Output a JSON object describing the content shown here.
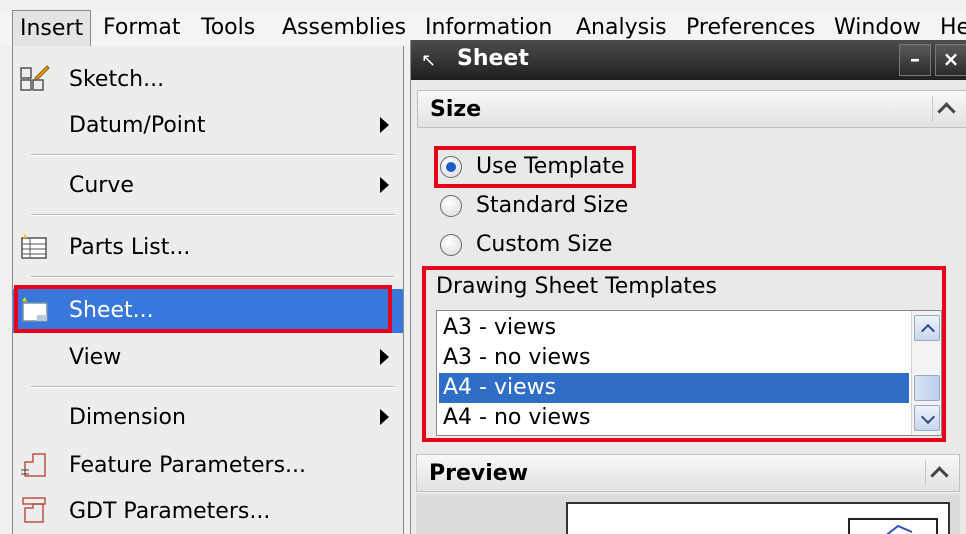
{
  "menubar": {
    "items": [
      "Insert",
      "Format",
      "Tools",
      "Assemblies",
      "Information",
      "Analysis",
      "Preferences",
      "Window",
      "He"
    ]
  },
  "insert_menu": {
    "items": [
      {
        "label": "Sketch...",
        "icon": "sketch-icon"
      },
      {
        "label": "Datum/Point",
        "submenu": true
      },
      {
        "label": "Curve",
        "submenu": true
      },
      {
        "label": "Parts List...",
        "icon": "parts-list-icon"
      },
      {
        "label": "Sheet...",
        "icon": "sheet-icon",
        "highlighted": true
      },
      {
        "label": "View",
        "submenu": true
      },
      {
        "label": "Dimension",
        "submenu": true
      },
      {
        "label": "Feature Parameters...",
        "icon": "feature-parameters-icon"
      },
      {
        "label": "GDT Parameters...",
        "icon": "gdt-parameters-icon"
      }
    ]
  },
  "sheet_panel": {
    "title": "Sheet",
    "size_group": {
      "title": "Size",
      "options": [
        "Use Template",
        "Standard Size",
        "Custom Size"
      ],
      "selected": "Use Template"
    },
    "templates": {
      "label": "Drawing Sheet Templates",
      "items": [
        "A3 - views",
        "A3 - no views",
        "A4 - views",
        "A4 - no views"
      ],
      "selected": "A4 - views"
    },
    "preview_group": {
      "title": "Preview"
    }
  },
  "colors": {
    "highlight_border": "#e8001c",
    "menu_selection": "#3878da",
    "list_selection": "#2f6ec7",
    "title_bar": "#2b2b2b"
  }
}
